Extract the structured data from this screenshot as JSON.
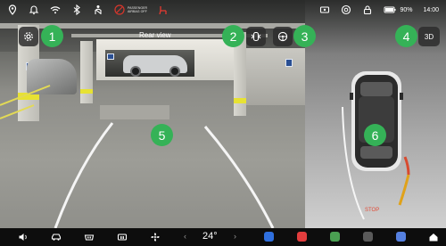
{
  "status_bar": {
    "airbag_line1": "PASSENGER",
    "airbag_line2": "AIRBAG OFF",
    "battery_percent": "90%",
    "time": "14:00",
    "icons_left": [
      "location-icon",
      "bell-icon",
      "wifi-icon",
      "bluetooth-icon",
      "seatbelt-icon",
      "airbag-off-icon",
      "seat-heat-icon"
    ],
    "icons_right": [
      "dashcam-icon",
      "tire-icon",
      "lock-icon",
      "battery-icon"
    ]
  },
  "camera": {
    "view_label": "Rear view"
  },
  "controls": {
    "view_3d_label": "3D"
  },
  "callouts": [
    "1",
    "2",
    "3",
    "4",
    "5",
    "6"
  ],
  "radar": {
    "stop_label": "STOP"
  },
  "dock": {
    "temperature": "24°",
    "prev": "‹",
    "next": "›"
  },
  "colors": {
    "callout": "#35b257",
    "stop": "#e24b37",
    "guide_yellow": "#e0a21a"
  }
}
